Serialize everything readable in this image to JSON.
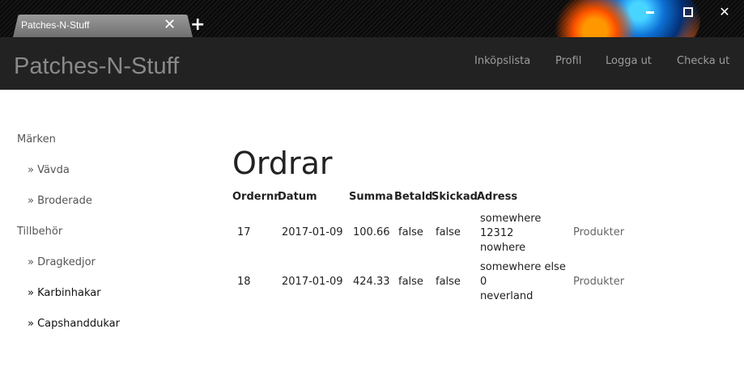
{
  "browser": {
    "tab_title": "Patches-N-Stuff",
    "tab_close": "✕",
    "new_tab": "+",
    "win_close": "✕"
  },
  "navbar": {
    "brand": "Patches-N-Stuff",
    "links": [
      "Inköpslista",
      "Profil",
      "Logga ut",
      "Checka ut"
    ]
  },
  "sidebar": {
    "groups": [
      {
        "label": "Märken",
        "items": [
          "» Vävda",
          "» Broderade"
        ]
      },
      {
        "label": "Tillbehör",
        "items": [
          "» Dragkedjor",
          "» Karbinhakar",
          "» Capshanddukar"
        ]
      }
    ]
  },
  "main": {
    "title": "Ordrar",
    "columns": [
      "Ordernr",
      "Datum",
      "Summa",
      "Betald",
      "Skickad",
      "Adress"
    ],
    "rows": [
      {
        "ordernr": "17",
        "datum": "2017-01-09",
        "summa": "100.66",
        "betald": "false",
        "skickad": "false",
        "adress": [
          "somewhere",
          "12312",
          "nowhere"
        ],
        "link": "Produkter"
      },
      {
        "ordernr": "18",
        "datum": "2017-01-09",
        "summa": "424.33",
        "betald": "false",
        "skickad": "false",
        "adress": [
          "somewhere else",
          "0",
          "neverland"
        ],
        "link": "Produkter"
      }
    ]
  }
}
